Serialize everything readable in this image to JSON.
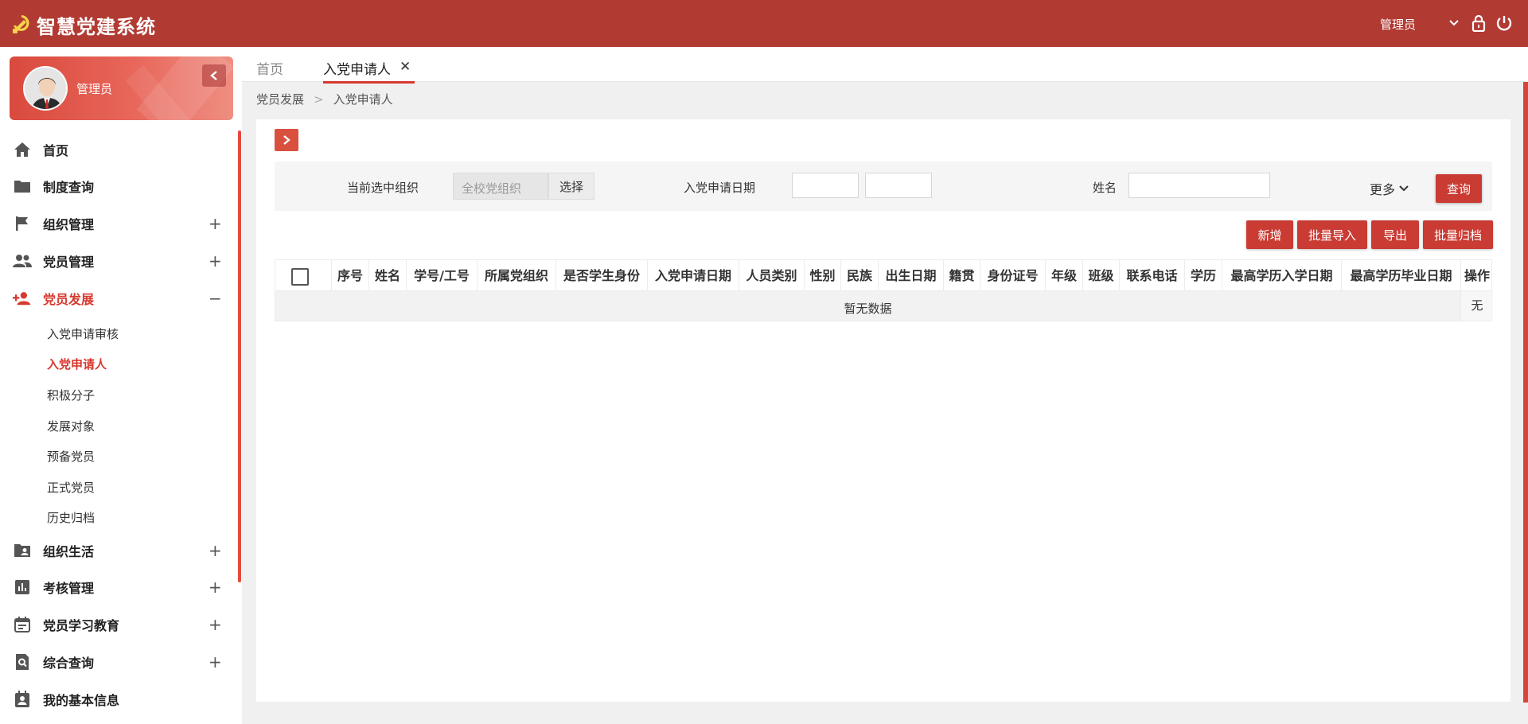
{
  "header": {
    "app_title": "智慧党建系统",
    "user_name": "管理员"
  },
  "sidebar": {
    "user_name": "管理员",
    "menu": [
      {
        "label": "首页",
        "icon": "home-icon",
        "toggle": ""
      },
      {
        "label": "制度查询",
        "icon": "folder-icon",
        "toggle": ""
      },
      {
        "label": "组织管理",
        "icon": "flag-icon",
        "toggle": "+"
      },
      {
        "label": "党员管理",
        "icon": "people-icon",
        "toggle": "+"
      },
      {
        "label": "党员发展",
        "icon": "add-user-icon",
        "toggle": "−"
      },
      {
        "label": "组织生活",
        "icon": "folder-user-icon",
        "toggle": "+"
      },
      {
        "label": "考核管理",
        "icon": "chart-icon",
        "toggle": "+"
      },
      {
        "label": "党员学习教育",
        "icon": "calendar-icon",
        "toggle": "+"
      },
      {
        "label": "综合查询",
        "icon": "search-doc-icon",
        "toggle": "+"
      },
      {
        "label": "我的基本信息",
        "icon": "profile-icon",
        "toggle": ""
      }
    ],
    "submenu": [
      {
        "label": "入党申请审核"
      },
      {
        "label": "入党申请人"
      },
      {
        "label": "积极分子"
      },
      {
        "label": "发展对象"
      },
      {
        "label": "预备党员"
      },
      {
        "label": "正式党员"
      },
      {
        "label": "历史归档"
      }
    ],
    "active_menu": "党员发展",
    "active_submenu": "入党申请人"
  },
  "tabs": {
    "home": "首页",
    "active": "入党申请人",
    "close_glyph": "✕"
  },
  "breadcrumb": {
    "parent": "党员发展",
    "separator": ">",
    "current": "入党申请人"
  },
  "filters": {
    "org_label": "当前选中组织",
    "org_value": "全校党组织",
    "org_select": "选择",
    "date_label": "入党申请日期",
    "date_from": "",
    "date_to": "",
    "name_label": "姓名",
    "name_value": "",
    "more": "更多",
    "query": "查询"
  },
  "actions": {
    "add": "新增",
    "batch_import": "批量导入",
    "export": "导出",
    "batch_archive": "批量归档"
  },
  "table": {
    "columns": [
      "序号",
      "姓名",
      "学号/工号",
      "所属党组织",
      "是否学生身份",
      "入党申请日期",
      "人员类别",
      "性别",
      "民族",
      "出生日期",
      "籍贯",
      "身份证号",
      "年级",
      "班级",
      "联系电话",
      "学历",
      "最高学历入学日期",
      "最高学历毕业日期",
      "操作"
    ],
    "empty_text": "暂无数据",
    "ops_empty": "无"
  },
  "colors": {
    "brand": "#b13a32",
    "accent": "#d63a2f",
    "button": "#c93b33"
  }
}
